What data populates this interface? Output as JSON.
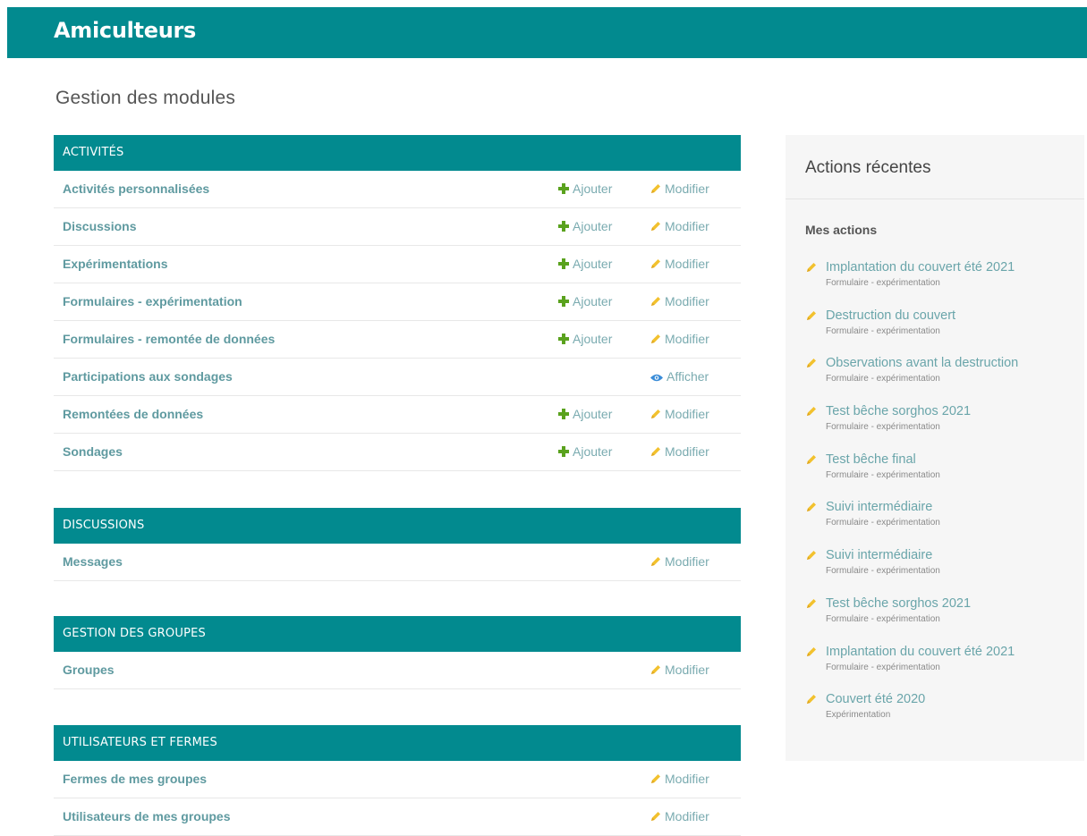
{
  "site": {
    "name": "Amiculteurs"
  },
  "page": {
    "title": "Gestion des modules"
  },
  "modules": [
    {
      "name": "ACTIVITÉS",
      "rows": [
        {
          "label": "Activités personnalisées",
          "add": "Ajouter",
          "change": "Modifier"
        },
        {
          "label": "Discussions",
          "add": "Ajouter",
          "change": "Modifier"
        },
        {
          "label": "Expérimentations",
          "add": "Ajouter",
          "change": "Modifier"
        },
        {
          "label": "Formulaires - expérimentation",
          "add": "Ajouter",
          "change": "Modifier"
        },
        {
          "label": "Formulaires - remontée de données",
          "add": "Ajouter",
          "change": "Modifier"
        },
        {
          "label": "Participations aux sondages",
          "view": "Afficher"
        },
        {
          "label": "Remontées de données",
          "add": "Ajouter",
          "change": "Modifier"
        },
        {
          "label": "Sondages",
          "add": "Ajouter",
          "change": "Modifier"
        }
      ]
    },
    {
      "name": "DISCUSSIONS",
      "rows": [
        {
          "label": "Messages",
          "change": "Modifier"
        }
      ]
    },
    {
      "name": "GESTION DES GROUPES",
      "rows": [
        {
          "label": "Groupes",
          "change": "Modifier"
        }
      ]
    },
    {
      "name": "UTILISATEURS ET FERMES",
      "rows": [
        {
          "label": "Fermes de mes groupes",
          "change": "Modifier"
        },
        {
          "label": "Utilisateurs de mes groupes",
          "change": "Modifier"
        }
      ]
    }
  ],
  "sidebar": {
    "title": "Actions récentes",
    "mine_title": "Mes actions",
    "items": [
      {
        "title": "Implantation du couvert été 2021",
        "type": "Formulaire - expérimentation"
      },
      {
        "title": "Destruction du couvert",
        "type": "Formulaire - expérimentation"
      },
      {
        "title": "Observations avant la destruction",
        "type": "Formulaire - expérimentation"
      },
      {
        "title": "Test bêche sorghos 2021",
        "type": "Formulaire - expérimentation"
      },
      {
        "title": "Test bêche final",
        "type": "Formulaire - expérimentation"
      },
      {
        "title": "Suivi intermédiaire",
        "type": "Formulaire - expérimentation"
      },
      {
        "title": "Suivi intermédiaire",
        "type": "Formulaire - expérimentation"
      },
      {
        "title": "Test bêche sorghos 2021",
        "type": "Formulaire - expérimentation"
      },
      {
        "title": "Implantation du couvert été 2021",
        "type": "Formulaire - expérimentation"
      },
      {
        "title": "Couvert été 2020",
        "type": "Expérimentation"
      }
    ]
  },
  "icons": {
    "add": "plus-icon",
    "change": "pencil-icon",
    "view": "eye-icon"
  },
  "colors": {
    "header": "#028a8f",
    "link": "#6aa5aa",
    "add": "#5aa21e",
    "pencil": "#f2c12e",
    "eye": "#3a8cd8"
  }
}
